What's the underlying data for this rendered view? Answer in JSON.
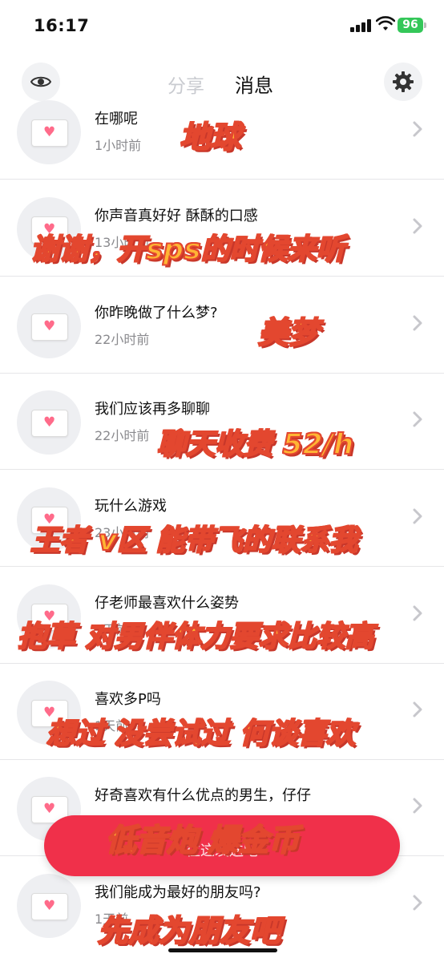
{
  "status_bar": {
    "time": "16:17",
    "battery": "96"
  },
  "header": {
    "tab_share": "分享",
    "tab_messages": "消息"
  },
  "messages": [
    {
      "text": "在哪呢",
      "time": "1小时前"
    },
    {
      "text": "你声音真好好 酥酥的口感",
      "time": "13小时前"
    },
    {
      "text": "你昨晚做了什么梦?",
      "time": "22小时前"
    },
    {
      "text": "我们应该再多聊聊",
      "time": "22小时前"
    },
    {
      "text": "玩什么游戏",
      "time": "23小时前"
    },
    {
      "text": "仔老师最喜欢什么姿势",
      "time": "1天前"
    },
    {
      "text": "喜欢多P吗",
      "time": "1天前"
    },
    {
      "text": "好奇喜欢有什么优点的男生，仔仔",
      "time": ""
    },
    {
      "text": "我们能成为最好的朋友吗?",
      "time": "1天前"
    }
  ],
  "captions": [
    "地球",
    "谢谢，开sps的时候来听",
    "美梦",
    "聊天收费 52/h",
    "王者 v区 能带飞的联系我",
    "抱草 对男伴体力要求比较高",
    "想过 没尝试过 何谈喜欢",
    "低音炮 爆金币",
    "先成为朋友吧"
  ],
  "floating_pill": {
    "text": "往这发送吧"
  },
  "colors": {
    "pill": "#f0304a",
    "caption_fill": "#ffb534",
    "caption_stroke": "#e3472f",
    "battery": "#34c759"
  },
  "icons": {
    "left_header": "eye-icon",
    "right_header": "gear-icon",
    "avatar": "envelope-heart-icon",
    "row_action": "chevron-right-icon"
  }
}
